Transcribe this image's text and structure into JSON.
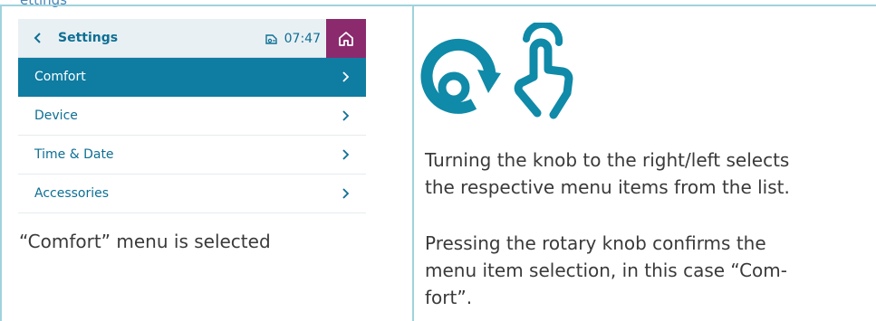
{
  "top_snippet": "ettings",
  "device": {
    "header": {
      "title": "Settings",
      "time": "07:47"
    },
    "menu_items": [
      {
        "label": "Comfort",
        "selected": true
      },
      {
        "label": "Device",
        "selected": false
      },
      {
        "label": "Time & Date",
        "selected": false
      },
      {
        "label": "Accessories",
        "selected": false
      }
    ],
    "colors": {
      "accent": "#0f7ca2",
      "home": "#8c2a6e",
      "header_bg": "#e9f0f3",
      "text": "#0d6f94"
    },
    "icons": {
      "back": "chevron-left-icon",
      "status": "hot-water-icon",
      "home": "home-icon",
      "row": "chevron-right-icon"
    }
  },
  "caption_left": "“Comfort” menu is selected",
  "instructions": {
    "icon": "rotary-knob-press-icon",
    "paragraph_1_line_1": "Turning the knob to the right/left selects",
    "paragraph_1_line_2": "the respective menu items from the list.",
    "paragraph_2_line_1": "Pressing the rotary knob confirms the",
    "paragraph_2_line_2": "menu item selection, in this case “Com-",
    "paragraph_2_line_3": "fort”."
  }
}
